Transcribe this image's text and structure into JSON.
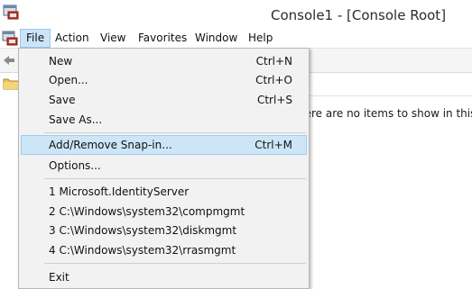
{
  "window": {
    "title": "Console1 - [Console Root]"
  },
  "menubar": {
    "items": [
      {
        "label": "File"
      },
      {
        "label": "Action"
      },
      {
        "label": "View"
      },
      {
        "label": "Favorites"
      },
      {
        "label": "Window"
      },
      {
        "label": "Help"
      }
    ]
  },
  "file_menu": {
    "new": {
      "label": "New",
      "shortcut": "Ctrl+N"
    },
    "open": {
      "label": "Open...",
      "shortcut": "Ctrl+O"
    },
    "save": {
      "label": "Save",
      "shortcut": "Ctrl+S"
    },
    "save_as": {
      "label": "Save As..."
    },
    "add_remove": {
      "label": "Add/Remove Snap-in...",
      "shortcut": "Ctrl+M"
    },
    "options": {
      "label": "Options..."
    },
    "recent": [
      "1 Microsoft.IdentityServer",
      "2 C:\\Windows\\system32\\compmgmt",
      "3 C:\\Windows\\system32\\diskmgmt",
      "4 C:\\Windows\\system32\\rrasmgmt"
    ],
    "exit": {
      "label": "Exit"
    }
  },
  "results": {
    "empty_message": "here are no items to show in this vi"
  }
}
